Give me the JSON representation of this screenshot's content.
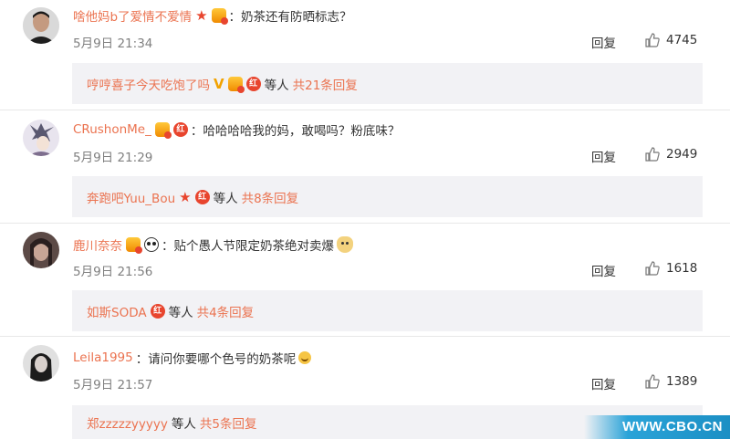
{
  "comments": [
    {
      "username": "啥他妈b了爱情不爱情",
      "text": "奶茶还有防晒标志？",
      "time": "5月9日 21:34",
      "reply_label": "回复",
      "likes": "4745",
      "avatar_color": "#2b2b2b",
      "sub": {
        "name": "哼哼喜子今天吃饱了吗",
        "others": "等人",
        "count": "共21条回复"
      }
    },
    {
      "username": "CRushonMe_",
      "text": "哈哈哈哈我的妈，敢喝吗？粉底味？",
      "time": "5月9日 21:29",
      "reply_label": "回复",
      "likes": "2949",
      "avatar_color": "#b9b3c7",
      "sub": {
        "name": "奔跑吧Yuu_Bou",
        "others": "等人",
        "count": "共8条回复"
      }
    },
    {
      "username": "鹿川奈奈",
      "text": "贴个愚人节限定奶茶绝对卖爆",
      "time": "5月9日 21:56",
      "reply_label": "回复",
      "likes": "1618",
      "avatar_color": "#4a3a38",
      "sub": {
        "name": "如斯SODA",
        "others": "等人",
        "count": "共4条回复"
      }
    },
    {
      "username": "Leila1995",
      "text": "请问你要哪个色号的奶茶呢",
      "time": "5月9日 21:57",
      "reply_label": "回复",
      "likes": "1389",
      "avatar_color": "#3a3a3a",
      "sub": {
        "name": "郑zzzzzyyyyy",
        "others": "等人",
        "count": "共5条回复"
      }
    }
  ],
  "colon": "：",
  "watermark": "WWW.CBO.CN",
  "colors": {
    "accent": "#eb7350",
    "sub_bg": "#f2f2f5",
    "badge_red": "#e8452e"
  }
}
